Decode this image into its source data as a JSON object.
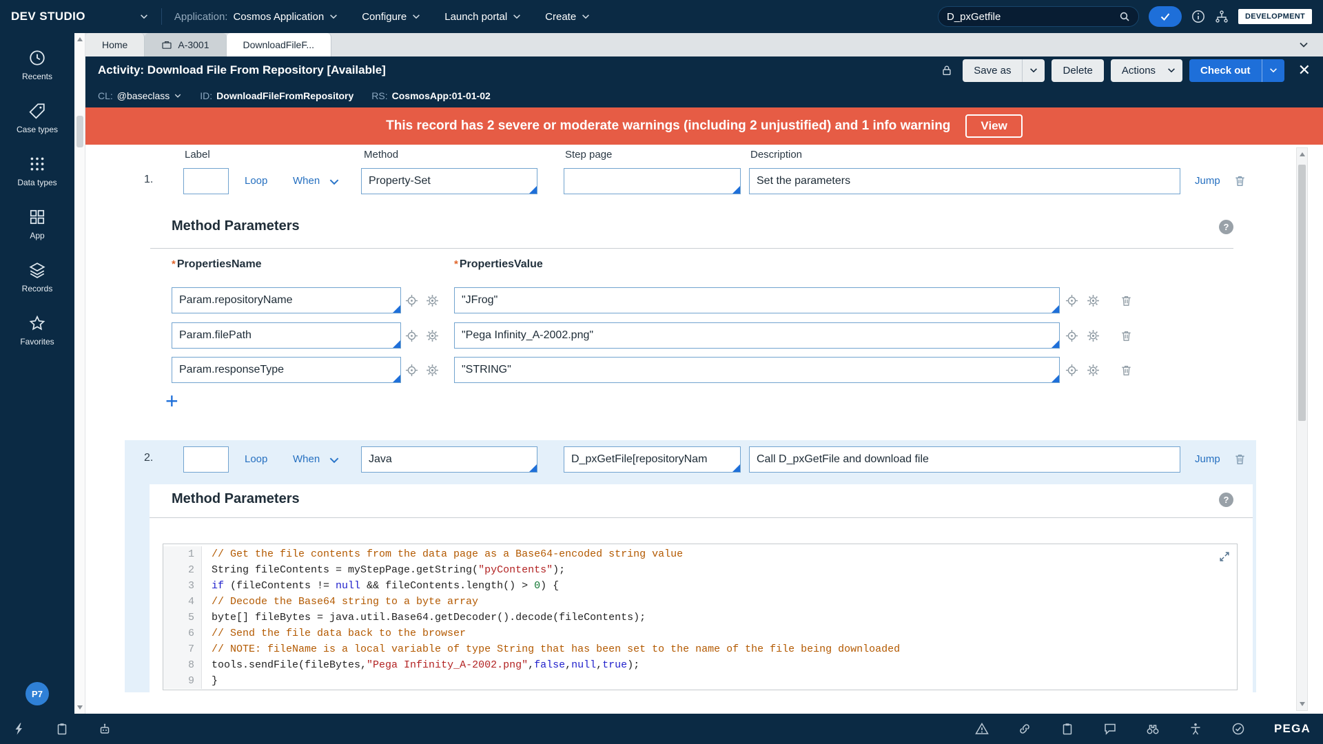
{
  "topbar": {
    "logo": "DEV STUDIO",
    "application_label": "Application:",
    "application_value": "Cosmos Application",
    "configure": "Configure",
    "launch_portal": "Launch portal",
    "create": "Create",
    "search_value": "D_pxGetfile",
    "env_badge": "DEVELOPMENT"
  },
  "sidebar": {
    "items": [
      {
        "label": "Recents"
      },
      {
        "label": "Case types"
      },
      {
        "label": "Data types"
      },
      {
        "label": "App"
      },
      {
        "label": "Records"
      },
      {
        "label": "Favorites"
      }
    ],
    "avatar": "P7"
  },
  "tabs": {
    "home": "Home",
    "case": "A-3001",
    "active": "DownloadFileF..."
  },
  "activity": {
    "title": "Activity: Download File From Repository [Available]",
    "cl_label": "CL:",
    "cl_value": "@baseclass",
    "id_label": "ID:",
    "id_value": "DownloadFileFromRepository",
    "rs_label": "RS:",
    "rs_value": "CosmosApp:01-01-02",
    "save_as": "Save as",
    "delete": "Delete",
    "actions": "Actions",
    "check_out": "Check out"
  },
  "banner": {
    "text": "This record has 2 severe or moderate warnings (including 2 unjustified) and 1 info warning",
    "view": "View"
  },
  "columns": {
    "label": "Label",
    "method": "Method",
    "step_page": "Step page",
    "description": "Description"
  },
  "steps": [
    {
      "number": "1.",
      "label": "",
      "loop": "Loop",
      "when": "When",
      "method": "Property-Set",
      "step_page": "",
      "description": "Set the parameters",
      "jump": "Jump"
    },
    {
      "number": "2.",
      "label": "",
      "loop": "Loop",
      "when": "When",
      "method": "Java",
      "step_page": "D_pxGetFile[repositoryNam",
      "description": "Call D_pxGetFile and download file",
      "jump": "Jump"
    }
  ],
  "params": {
    "title": "Method Parameters",
    "name_header": "PropertiesName",
    "value_header": "PropertiesValue",
    "rows": [
      {
        "name": "Param.repositoryName",
        "value": "\"JFrog\""
      },
      {
        "name": "Param.filePath",
        "value": "\"Pega Infinity_A-2002.png\""
      },
      {
        "name": "Param.responseType",
        "value": "\"STRING\""
      }
    ]
  },
  "java_params": {
    "title": "Method Parameters"
  },
  "code": {
    "lines": [
      {
        "n": "1",
        "segs": [
          {
            "c": "com",
            "t": "// Get the file contents from the data page as a Base64-encoded string value"
          }
        ]
      },
      {
        "n": "2",
        "segs": [
          {
            "c": "pln",
            "t": "String fileContents = myStepPage.getString("
          },
          {
            "c": "str",
            "t": "\"pyContents\""
          },
          {
            "c": "pln",
            "t": ");"
          }
        ]
      },
      {
        "n": "3",
        "segs": [
          {
            "c": "kw",
            "t": "if"
          },
          {
            "c": "pln",
            "t": " (fileContents != "
          },
          {
            "c": "kw",
            "t": "null"
          },
          {
            "c": "pln",
            "t": " && fileContents.length() > "
          },
          {
            "c": "num",
            "t": "0"
          },
          {
            "c": "pln",
            "t": ") {"
          }
        ]
      },
      {
        "n": "4",
        "segs": [
          {
            "c": "com",
            "t": "// Decode the Base64 string to a byte array"
          }
        ]
      },
      {
        "n": "5",
        "segs": [
          {
            "c": "pln",
            "t": "byte[] fileBytes = java.util.Base64.getDecoder().decode(fileContents);"
          }
        ]
      },
      {
        "n": "6",
        "segs": [
          {
            "c": "com",
            "t": "// Send the file data back to the browser"
          }
        ]
      },
      {
        "n": "7",
        "segs": [
          {
            "c": "com",
            "t": "// NOTE: fileName is a local variable of type String that has been set to the name of the file being downloaded"
          }
        ]
      },
      {
        "n": "8",
        "segs": [
          {
            "c": "pln",
            "t": "tools.sendFile(fileBytes,"
          },
          {
            "c": "str",
            "t": "\"Pega Infinity_A-2002.png\""
          },
          {
            "c": "pln",
            "t": ","
          },
          {
            "c": "kw",
            "t": "false"
          },
          {
            "c": "pln",
            "t": ","
          },
          {
            "c": "kw",
            "t": "null"
          },
          {
            "c": "pln",
            "t": ","
          },
          {
            "c": "kw",
            "t": "true"
          },
          {
            "c": "pln",
            "t": ");"
          }
        ]
      },
      {
        "n": "9",
        "segs": [
          {
            "c": "pln",
            "t": "}"
          }
        ]
      }
    ]
  },
  "bottombar": {
    "brand": "PEGA"
  },
  "misc": {
    "help": "?",
    "plus": "+",
    "close": "✕",
    "required_marker": "*"
  }
}
